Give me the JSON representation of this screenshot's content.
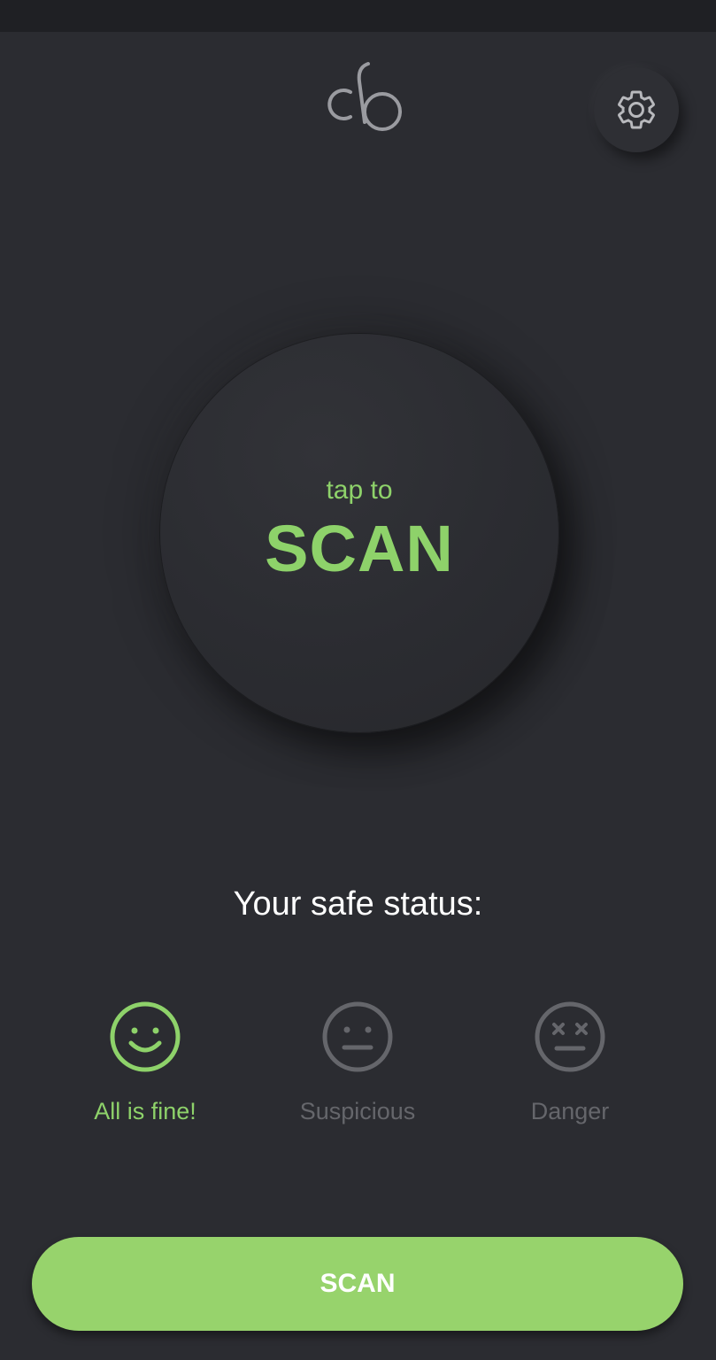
{
  "header": {
    "logo_icon": "cb-logo-icon",
    "settings_icon": "gear-icon"
  },
  "scan_circle": {
    "subtitle": "tap to",
    "title": "SCAN"
  },
  "status": {
    "title": "Your safe status:",
    "items": [
      {
        "label": "All is fine!",
        "icon": "smile-face-icon",
        "active": true,
        "color": "#8ed26a"
      },
      {
        "label": "Suspicious",
        "icon": "neutral-face-icon",
        "active": false,
        "color": "#65666b"
      },
      {
        "label": "Danger",
        "icon": "dead-face-icon",
        "active": false,
        "color": "#65666b"
      }
    ]
  },
  "bottom_button": {
    "label": "SCAN"
  },
  "colors": {
    "background": "#2b2c31",
    "accent": "#8ed26a",
    "button": "#97d36c",
    "inactive": "#65666b"
  }
}
